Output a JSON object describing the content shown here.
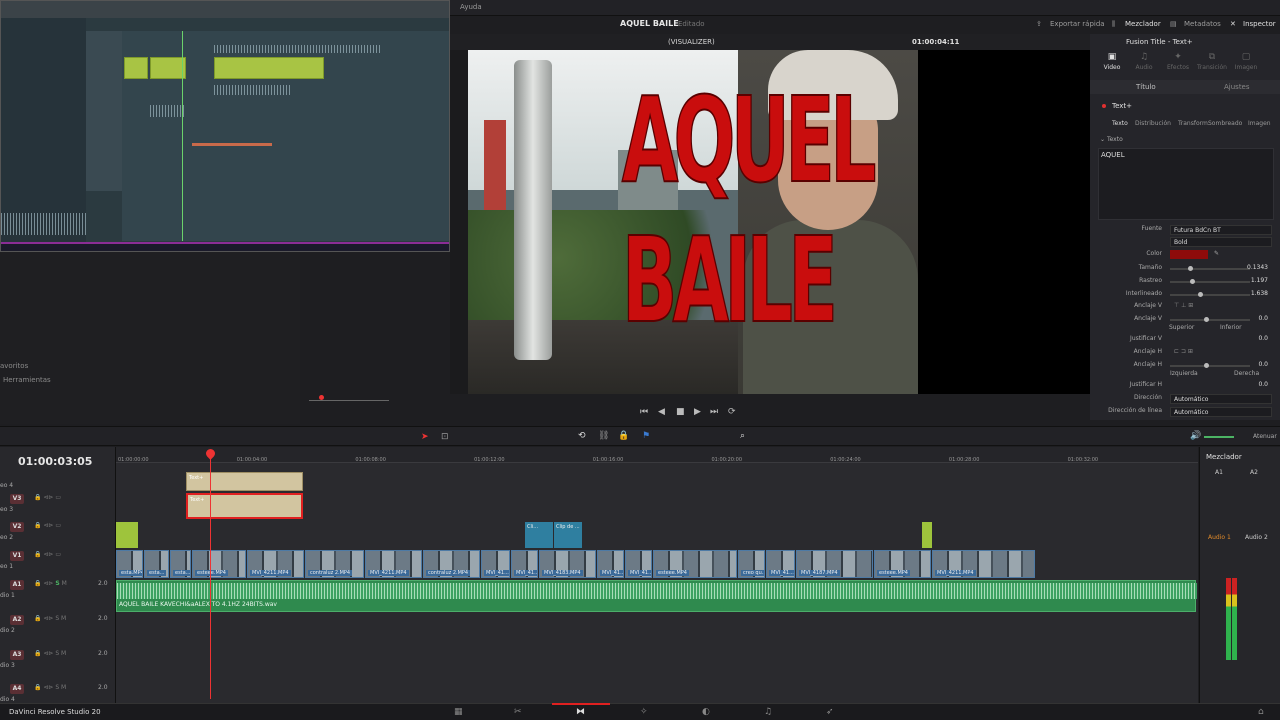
{
  "menu": {
    "ayuda": "Ayuda"
  },
  "header": {
    "project_title": "AQUEL BAILE",
    "status": "Editado"
  },
  "top_right": {
    "quick_export": "Exportar rápida",
    "mixer": "Mezclador",
    "metadata": "Metadatos",
    "inspector": "Inspector"
  },
  "viewer": {
    "clip_name": "(VISUALIZER)",
    "timecode": "01:00:04:11",
    "overlay_text": "AQUEL BAILE"
  },
  "inspector": {
    "title": "Fusion Title - Text+",
    "tabs": [
      "Video",
      "Audio",
      "Efectos",
      "Transición",
      "Imagen",
      "Archivo"
    ],
    "subtabs": {
      "titulo": "Título",
      "ajustes": "Ajustes"
    },
    "tool_name": "Text+",
    "text_tabs": [
      "Texto",
      "Distribución",
      "Transform.",
      "Sombreado",
      "Imagen"
    ],
    "text_section": "Texto",
    "text_value": "AQUEL",
    "font_label": "Fuente",
    "font_value": "Futura BdCn BT",
    "style_value": "Bold",
    "color_label": "Color",
    "color_value": "#8e0b0b",
    "size_label": "Tamaño",
    "size_value": "0.1343",
    "tracking_label": "Rastreo",
    "tracking_value": "1.197",
    "leading_label": "Interlineado",
    "leading_value": "1.638",
    "anchor_v_label": "Anclaje V",
    "anchor_v2_label": "Anclaje V",
    "anchor_v2_value": "0.0",
    "sup": "Superior",
    "inf": "Inferior",
    "justify_v_label": "Justificar V",
    "justify_v_value": "0.0",
    "anchor_h_label": "Anclaje H",
    "anchor_h2_label": "Anclaje H",
    "anchor_h2_value": "0.0",
    "izq": "Izquierda",
    "der": "Derecha",
    "justify_h_label": "Justificar H",
    "justify_h_value": "0.0",
    "direction_label": "Dirección",
    "direction_value": "Automático",
    "line_direction_label": "Dirección de línea",
    "line_direction_value": "Automático"
  },
  "left_panel": {
    "favoritos": "avoritos",
    "herramientas": "Herramientas"
  },
  "timeline": {
    "timecode": "01:00:03:05",
    "ruler": [
      "01:00:00:00",
      "01:00:04:00",
      "01:00:08:00",
      "01:00:12:00",
      "01:00:16:00",
      "01:00:20:00",
      "01:00:24:00",
      "01:00:28:00",
      "01:00:32:00"
    ],
    "tracks": {
      "v4": "eo 4",
      "v3": "V3",
      "v3n": "eo 3",
      "v2": "V2",
      "v2n": "eo 2",
      "v1": "V1",
      "v1n": "eo 1",
      "a1": "A1",
      "a1n": "dio 1",
      "a2": "A2",
      "a2n": "dio 2",
      "a3": "A3",
      "a3n": "dio 3",
      "a4": "A4",
      "a4n": "dio 4",
      "vol": "2.0"
    },
    "text_clip": "Text+",
    "v2_clips": [
      "Cli...",
      "Clip de ..."
    ],
    "v1_clips": [
      "esta.MP4",
      "esta...",
      "esta...",
      "esteee.MP4",
      "MVI_4211.MP4",
      "contraluz 2.MP4",
      "MVI_4211.MP4",
      "contraluz 2.MP4",
      "MVI_41...",
      "MVI_41...",
      "MVI_4183.MP4",
      "MVI_41...",
      "MVI_41...",
      "esteee.MP4",
      "creo qu...",
      "MVI_41...",
      "MVI_4187.MP4",
      "esteee.MP4",
      "MVI_4211.MP4"
    ],
    "audio_clip": "AQUEL BAILE KAVECHI&aALEXITO 4.1HZ 24BITS.wav",
    "atenuar": "Atenuar"
  },
  "mixer": {
    "title": "Mezclador",
    "ch_a1": "A1",
    "ch_a2": "A2",
    "audio1": "Audio 1",
    "audio2": "Audio 2"
  },
  "bottom": {
    "app_name": "DaVinci Resolve Studio 20"
  }
}
